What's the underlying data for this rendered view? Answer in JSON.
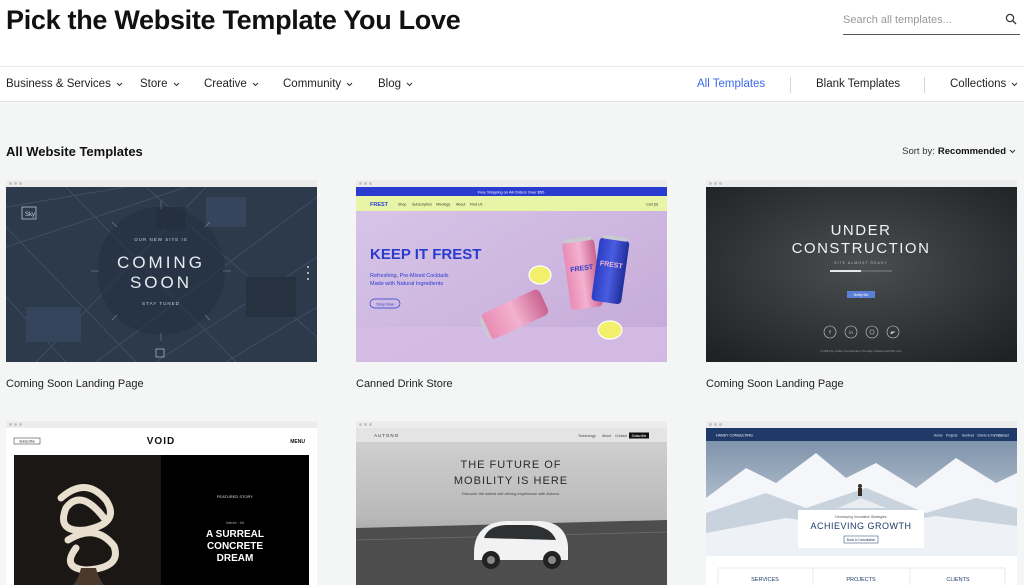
{
  "header": {
    "title": "Pick the Website Template You Love",
    "search_placeholder": "Search all templates..."
  },
  "nav": {
    "categories": [
      "Business & Services",
      "Store",
      "Creative",
      "Community",
      "Blog"
    ],
    "right": {
      "all_templates": "All Templates",
      "blank_templates": "Blank Templates",
      "collections": "Collections"
    },
    "accent_color": "#3b69e8"
  },
  "main": {
    "section_title": "All Website Templates",
    "sort_prefix": "Sort by:",
    "sort_value": "Recommended"
  },
  "templates": [
    {
      "label": "Coming Soon Landing Page",
      "preview": {
        "logo": "Sky",
        "kicker": "OUR NEW SITE IS",
        "heading_1": "COMING",
        "heading_2": "SOON",
        "footer": "STAY TUNED"
      }
    },
    {
      "label": "Canned Drink Store",
      "preview": {
        "banner": "Free Shipping on All Orders Over $50",
        "brand": "FREST",
        "menu": [
          "Shop",
          "Subscription",
          "Mixology",
          "About",
          "Find Us"
        ],
        "cart": "Cart (0)",
        "heading": "KEEP IT FREST",
        "subtext_1": "Refreshing, Pre-Mixed Cocktails",
        "subtext_2": "Made with Natural Ingredients",
        "cta": "Shop Now",
        "can_label": "FREST"
      }
    },
    {
      "label": "Coming Soon Landing Page",
      "preview": {
        "heading_1": "UNDER",
        "heading_2": "CONSTRUCTION",
        "sub": "SITE ALMOST READY",
        "progress_value": 0.5,
        "cta": "Notify Me",
        "footer": "© 2023 by Under Construction. Proudly created with Wix.com"
      }
    },
    {
      "label": "",
      "preview": {
        "subscribe": "Subscribe",
        "brand": "VOID",
        "menu": "MENU",
        "featured": "FEATURED STORY",
        "kicker": "Interior · Art",
        "heading_1": "A SURREAL",
        "heading_2": "CONCRETE",
        "heading_3": "DREAM"
      }
    },
    {
      "label": "",
      "preview": {
        "brand": "AUTONO",
        "menu": [
          "Technology",
          "About",
          "Contact"
        ],
        "cta": "Subscribe",
        "heading_1": "THE FUTURE OF",
        "heading_2": "MOBILITY IS HERE",
        "sub": "Discover the safest self-driving experience with Autono."
      }
    },
    {
      "label": "",
      "preview": {
        "brand": "HANDY CONSULTING",
        "menu": [
          "Home",
          "Projects",
          "Services",
          "Clients & Partners",
          "Contact"
        ],
        "kicker": "Developing Innovative Strategies",
        "heading": "ACHIEVING GROWTH",
        "cta": "Book A Consultation",
        "tabs": [
          "SERVICES",
          "PROJECTS",
          "CLIENTS"
        ]
      }
    }
  ]
}
